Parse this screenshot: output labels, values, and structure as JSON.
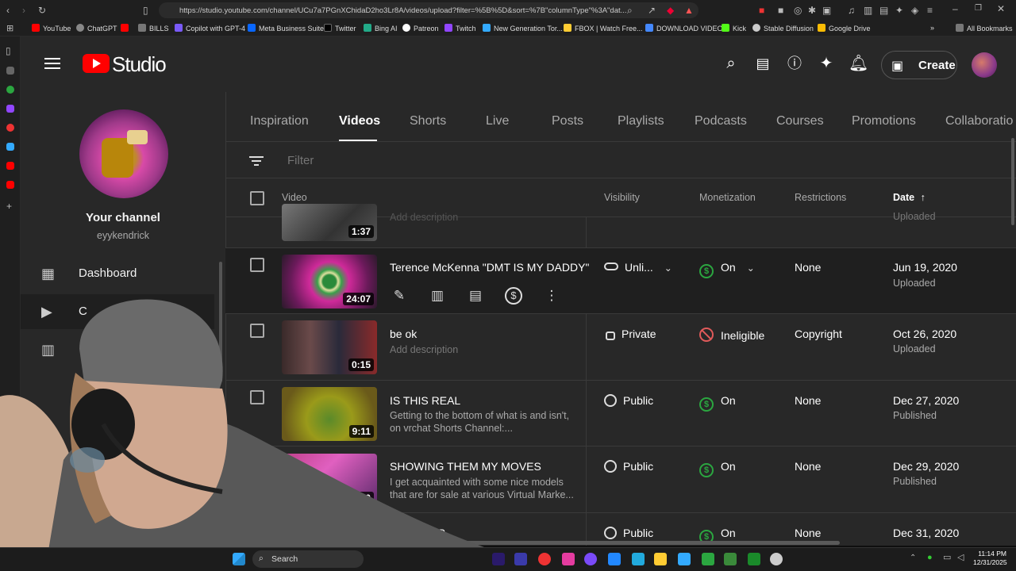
{
  "browser": {
    "url": "https://studio.youtube.com/channel/UCu7a7PGnXChidaD2ho3Lr8A/videos/upload?filter=%5B%5D&sort=%7B\"columnType\"%3A\"dat...",
    "bookmarks": [
      "YouTube",
      "ChatGPT",
      "BILLS",
      "Copilot with GPT-4",
      "Meta Business Suite",
      "Twitter",
      "Bing AI",
      "Patreon",
      "Twitch",
      "New Generation Tor...",
      "FBOX | Watch Free...",
      "DOWNLOAD VIDEO",
      "Kick",
      "Stable Diffusion",
      "Google Drive"
    ],
    "all_bookmarks": "All Bookmarks"
  },
  "header": {
    "logo_text": "Studio",
    "create_label": "Create"
  },
  "sidebar": {
    "channel_title": "Your channel",
    "channel_handle": "eyykendrick",
    "items": [
      {
        "label": "Dashboard",
        "icon": "dashboard-icon"
      },
      {
        "label": "C",
        "icon": "content-icon"
      },
      {
        "label": "",
        "icon": "analytics-icon"
      }
    ]
  },
  "tabs": [
    "Inspiration",
    "Videos",
    "Shorts",
    "Live",
    "Posts",
    "Playlists",
    "Podcasts",
    "Courses",
    "Promotions",
    "Collaboratio"
  ],
  "active_tab": "Videos",
  "filter": {
    "placeholder": "Filter"
  },
  "columns": {
    "video": "Video",
    "visibility": "Visibility",
    "monetization": "Monetization",
    "restrictions": "Restrictions",
    "date": "Date"
  },
  "videos": [
    {
      "title": "",
      "description": "Add description",
      "duration": "1:37",
      "visibility": "",
      "monetization": "",
      "restrictions": "",
      "date": "",
      "status": "Uploaded"
    },
    {
      "title": "Terence McKenna \"DMT IS MY DADDY\"",
      "description": "",
      "duration": "24:07",
      "visibility": "Unli...",
      "monetization": "On",
      "restrictions": "None",
      "date": "Jun 19, 2020",
      "status": "Uploaded"
    },
    {
      "title": "be ok",
      "description": "Add description",
      "duration": "0:15",
      "visibility": "Private",
      "monetization": "Ineligible",
      "restrictions": "Copyright",
      "date": "Oct 26, 2020",
      "status": "Uploaded"
    },
    {
      "title": "IS THIS REAL",
      "description": "Getting to the bottom of what is and isn't, on vrchat Shorts Channel:...",
      "duration": "9:11",
      "visibility": "Public",
      "monetization": "On",
      "restrictions": "None",
      "date": "Dec 27, 2020",
      "status": "Published"
    },
    {
      "title": "SHOWING THEM MY MOVES",
      "description": "I get acquainted with some nice models that are for sale at various Virtual Marke...",
      "duration": "10:00",
      "visibility": "Public",
      "monetization": "On",
      "restrictions": "None",
      "date": "Dec 29, 2020",
      "status": "Published"
    },
    {
      "title": "...P",
      "description": "",
      "duration": "",
      "visibility": "Public",
      "monetization": "On",
      "restrictions": "None",
      "date": "Dec 31, 2020",
      "status": ""
    }
  ],
  "taskbar": {
    "search_label": "Search",
    "time": "11:14 PM",
    "date": "12/31/2025"
  }
}
